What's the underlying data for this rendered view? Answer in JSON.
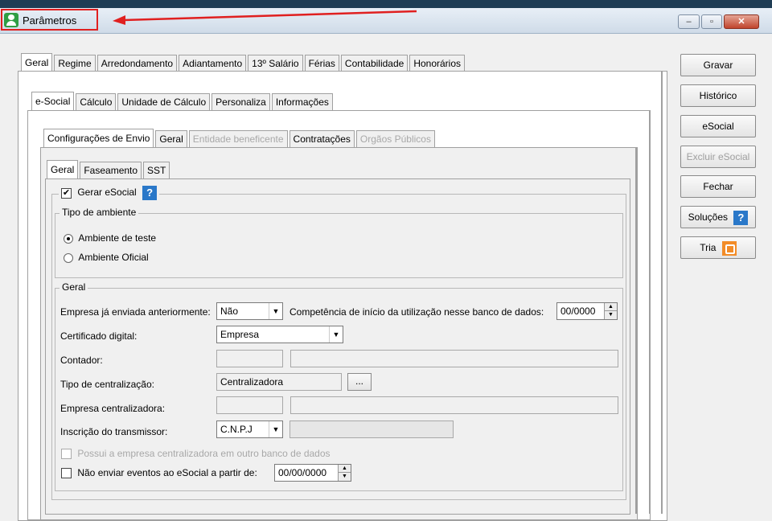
{
  "window": {
    "title": "Parâmetros",
    "minimize": "–",
    "maximize": "▫",
    "close": "✕"
  },
  "tabs_main": [
    "Geral",
    "Regime",
    "Arredondamento",
    "Adiantamento",
    "13º Salário",
    "Férias",
    "Contabilidade",
    "Honorários"
  ],
  "tabs_second": [
    "e-Social",
    "Cálculo",
    "Unidade de Cálculo",
    "Personaliza",
    "Informações"
  ],
  "tabs_third": [
    "Configurações de Envio",
    "Geral",
    "Entidade beneficente",
    "Contratações",
    "Orgãos Públicos"
  ],
  "tabs_fourth": [
    "Geral",
    "Faseamento",
    "SST"
  ],
  "buttons": {
    "gravar": "Gravar",
    "historico": "Histórico",
    "esocial": "eSocial",
    "excluir": "Excluir eSocial",
    "fechar": "Fechar",
    "solucoes": "Soluções",
    "tria": "Tria"
  },
  "esocial": {
    "gerar_label": "Gerar eSocial",
    "gerar_checked": "✔",
    "help_glyph": "?",
    "ambiente": {
      "legend": "Tipo de ambiente",
      "teste": "Ambiente de teste",
      "oficial": "Ambiente Oficial"
    },
    "geral": {
      "legend": "Geral",
      "empresa_enviada_label": "Empresa já enviada anteriormente:",
      "empresa_enviada_value": "Não",
      "competencia_label": "Competência de início da utilização nesse banco de dados:",
      "competencia_value": "00/0000",
      "certificado_label": "Certificado digital:",
      "certificado_value": "Empresa",
      "contador_label": "Contador:",
      "tipo_centralizacao_label": "Tipo de centralização:",
      "tipo_centralizacao_value": "Centralizadora",
      "browse_glyph": "...",
      "empresa_centralizadora_label": "Empresa centralizadora:",
      "inscricao_label": "Inscrição do transmissor:",
      "inscricao_type": "C.N.P.J",
      "possui_label": "Possui a empresa centralizadora em outro banco de dados",
      "nao_enviar_label": "Não enviar eventos ao eSocial a partir de:",
      "nao_enviar_date": "00/00/0000"
    }
  },
  "glyphs": {
    "dropdown": "▼",
    "spin_up": "▲",
    "spin_down": "▼"
  }
}
